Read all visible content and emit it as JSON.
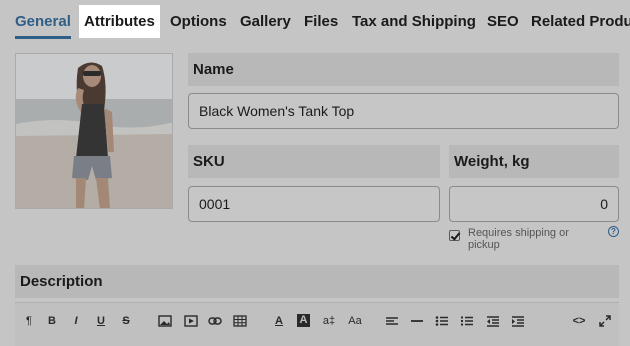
{
  "tabs": [
    {
      "label": "General",
      "active": true
    },
    {
      "label": "Attributes",
      "highlight": true
    },
    {
      "label": "Options"
    },
    {
      "label": "Gallery"
    },
    {
      "label": "Files"
    },
    {
      "label": "Tax and Shipping"
    },
    {
      "label": "SEO"
    },
    {
      "label": "Related Produ"
    }
  ],
  "fields": {
    "name": {
      "label": "Name",
      "value": "Black Women's Tank Top"
    },
    "sku": {
      "label": "SKU",
      "value": "0001"
    },
    "weight": {
      "label": "Weight, kg",
      "value": "0"
    }
  },
  "shipping": {
    "label": "Requires shipping or pickup",
    "checked": true,
    "help_icon": "question-circle-icon",
    "help_glyph": "?"
  },
  "description": {
    "label": "Description"
  },
  "toolbar": {
    "buttons": [
      {
        "name": "paragraph-icon",
        "glyph": "¶"
      },
      {
        "name": "bold-icon",
        "glyph": "B"
      },
      {
        "name": "italic-icon",
        "glyph": "I"
      },
      {
        "name": "underline-icon",
        "glyph": "U"
      },
      {
        "name": "strikethrough-icon",
        "glyph": "S"
      },
      {
        "name": "image-icon",
        "glyph": ""
      },
      {
        "name": "video-icon",
        "glyph": ""
      },
      {
        "name": "link-icon",
        "glyph": ""
      },
      {
        "name": "table-icon",
        "glyph": ""
      },
      {
        "name": "font-color-icon",
        "glyph": "A"
      },
      {
        "name": "background-color-icon",
        "glyph": "A"
      },
      {
        "name": "font-size-icon",
        "glyph": "a‡"
      },
      {
        "name": "text-case-icon",
        "glyph": "Aa"
      },
      {
        "name": "align-icon",
        "glyph": ""
      },
      {
        "name": "horizontal-rule-icon",
        "glyph": ""
      },
      {
        "name": "unordered-list-icon",
        "glyph": ""
      },
      {
        "name": "ordered-list-icon",
        "glyph": ""
      },
      {
        "name": "outdent-icon",
        "glyph": ""
      },
      {
        "name": "indent-icon",
        "glyph": ""
      },
      {
        "name": "code-view-icon",
        "glyph": "<>"
      },
      {
        "name": "fullscreen-icon",
        "glyph": ""
      }
    ]
  },
  "colors": {
    "accent": "#2f5e86",
    "overlay": "#c5c5c5"
  }
}
